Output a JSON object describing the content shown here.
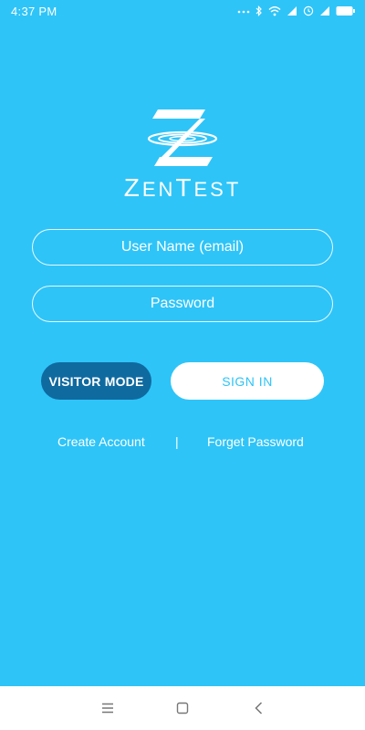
{
  "status_bar": {
    "time": "4:37 PM",
    "battery": "battery-full"
  },
  "logo": {
    "icon": "zentest-logo-icon",
    "text_first": "Z",
    "text_mid": "EN",
    "text_t": "T",
    "text_end": "EST"
  },
  "form": {
    "username_placeholder": "User Name (email)",
    "username_value": "",
    "password_placeholder": "Password",
    "password_value": ""
  },
  "buttons": {
    "visitor_label": "VISITOR MODE",
    "signin_label": "SIGN IN"
  },
  "links": {
    "create_account": "Create Account",
    "separator": "|",
    "forget_password": "Forget Password"
  },
  "nav": {
    "menu": "menu-icon",
    "home": "home-icon",
    "back": "back-icon"
  },
  "colors": {
    "background": "#2ec4f8",
    "visitor_button": "#0f6aa0",
    "signin_text": "#2ec4f8"
  }
}
